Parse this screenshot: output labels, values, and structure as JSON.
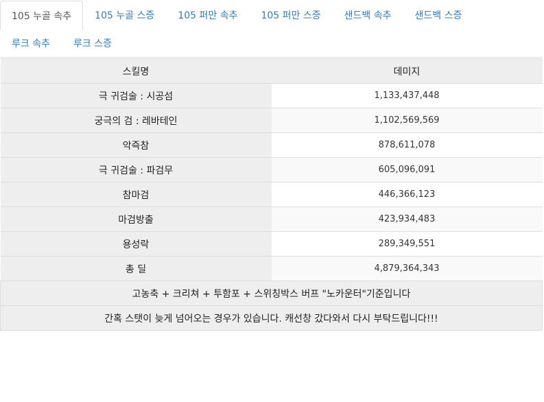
{
  "tabs": [
    {
      "label": "105 누골 속추",
      "active": true
    },
    {
      "label": "105 누골 스증",
      "active": false
    },
    {
      "label": "105 퍼만 속추",
      "active": false
    },
    {
      "label": "105 퍼만 스증",
      "active": false
    },
    {
      "label": "샌드백 속추",
      "active": false
    },
    {
      "label": "샌드백 스증",
      "active": false
    },
    {
      "label": "루크 속추",
      "active": false
    },
    {
      "label": "루크 스증",
      "active": false
    }
  ],
  "table": {
    "headers": {
      "skill": "스킬명",
      "damage": "데미지"
    },
    "rows": [
      {
        "skill": "극 귀검술 : 시공섬",
        "damage": "1,133,437,448"
      },
      {
        "skill": "궁극의 검 : 레바테인",
        "damage": "1,102,569,569"
      },
      {
        "skill": "악즉참",
        "damage": "878,611,078"
      },
      {
        "skill": "극 귀검술 : 파검무",
        "damage": "605,096,091"
      },
      {
        "skill": "참마검",
        "damage": "446,366,123"
      },
      {
        "skill": "마검방출",
        "damage": "423,934,483"
      },
      {
        "skill": "용성락",
        "damage": "289,349,551"
      },
      {
        "skill": "총 딜",
        "damage": "4,879,364,343"
      }
    ],
    "notes": [
      "고농축 + 크리쳐 + 투함포 + 스위칭박스 버프 \"노카운터\"기준입니다",
      "간혹 스탯이 늦게 넘어오는 경우가 있습니다. 캐선창 갔다와서 다시 부탁드립니다!!!"
    ]
  }
}
